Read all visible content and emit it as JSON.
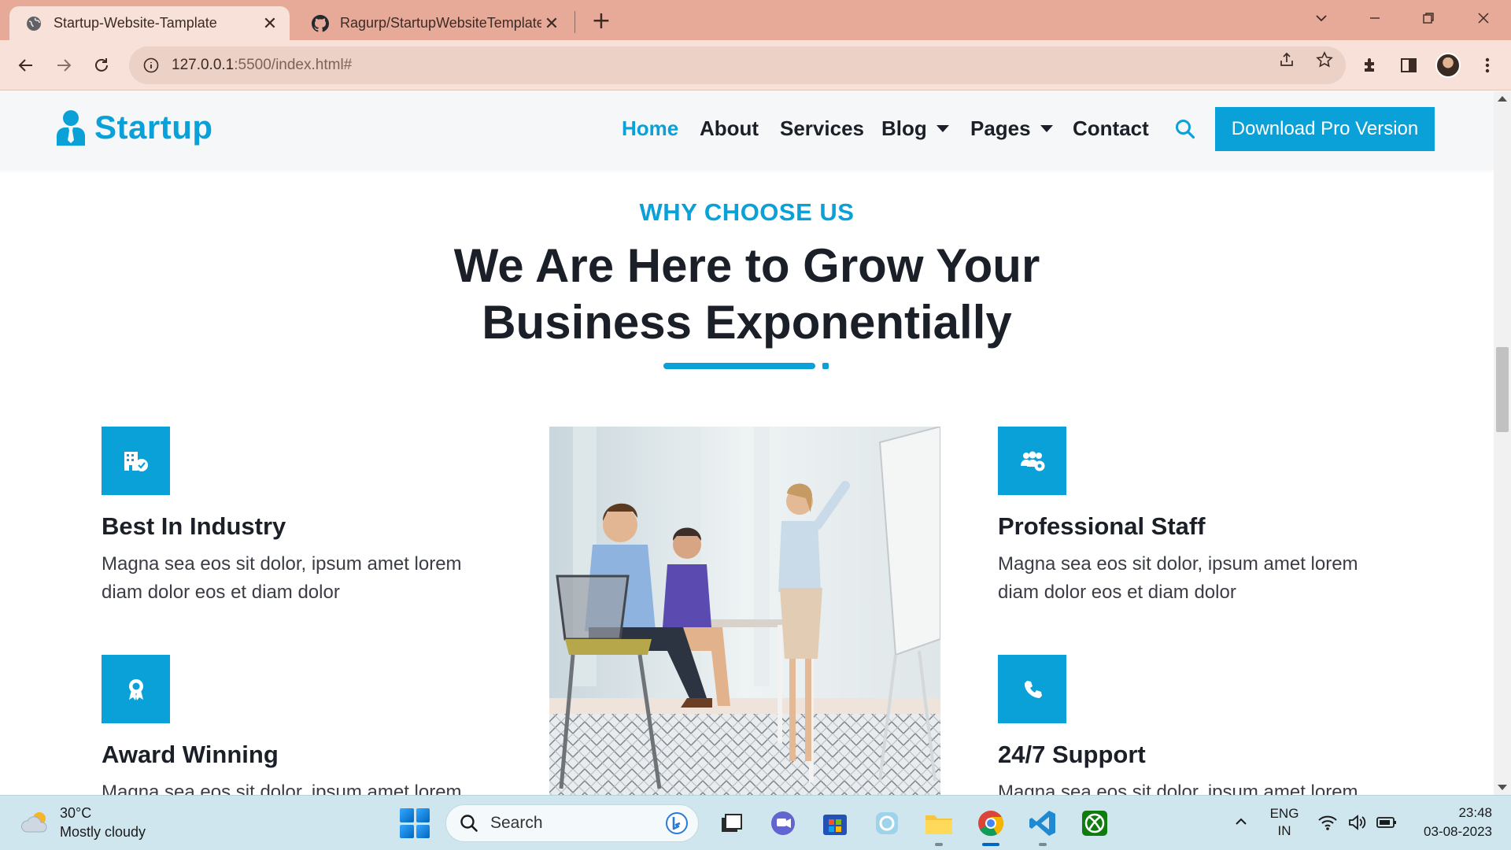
{
  "browser": {
    "tabs": [
      {
        "title": "Startup-Website-Tamplate",
        "active": true,
        "icon": "globe-icon"
      },
      {
        "title": "Ragurp/StartupWebsiteTemplate",
        "active": false,
        "icon": "github-icon"
      }
    ],
    "url_host": "127.0.0.1",
    "url_rest": ":5500/index.html#"
  },
  "site": {
    "brand": "Startup",
    "nav": [
      "Home",
      "About",
      "Services",
      "Blog",
      "Pages",
      "Contact"
    ],
    "cta": "Download Pro Version",
    "accent": "#0aa0d8"
  },
  "section": {
    "subtitle": "WHY CHOOSE US",
    "title_line1": "We Are Here to Grow Your",
    "title_line2": "Business Exponentially"
  },
  "features": [
    {
      "title": "Best In Industry",
      "text": "Magna sea eos sit dolor, ipsum amet lorem diam dolor eos et diam dolor",
      "icon": "building-check-icon"
    },
    {
      "title": "Award Winning",
      "text": "Magna sea eos sit dolor, ipsum amet lorem",
      "icon": "award-icon"
    },
    {
      "title": "Professional Staff",
      "text": "Magna sea eos sit dolor, ipsum amet lorem diam dolor eos et diam dolor",
      "icon": "users-gear-icon"
    },
    {
      "title": "24/7 Support",
      "text": "Magna sea eos sit dolor, ipsum amet lorem",
      "icon": "phone-icon"
    }
  ],
  "taskbar": {
    "weather_temp": "30°C",
    "weather_desc": "Mostly cloudy",
    "search_placeholder": "Search",
    "lang_line1": "ENG",
    "lang_line2": "IN",
    "time": "23:48",
    "date": "03-08-2023"
  }
}
